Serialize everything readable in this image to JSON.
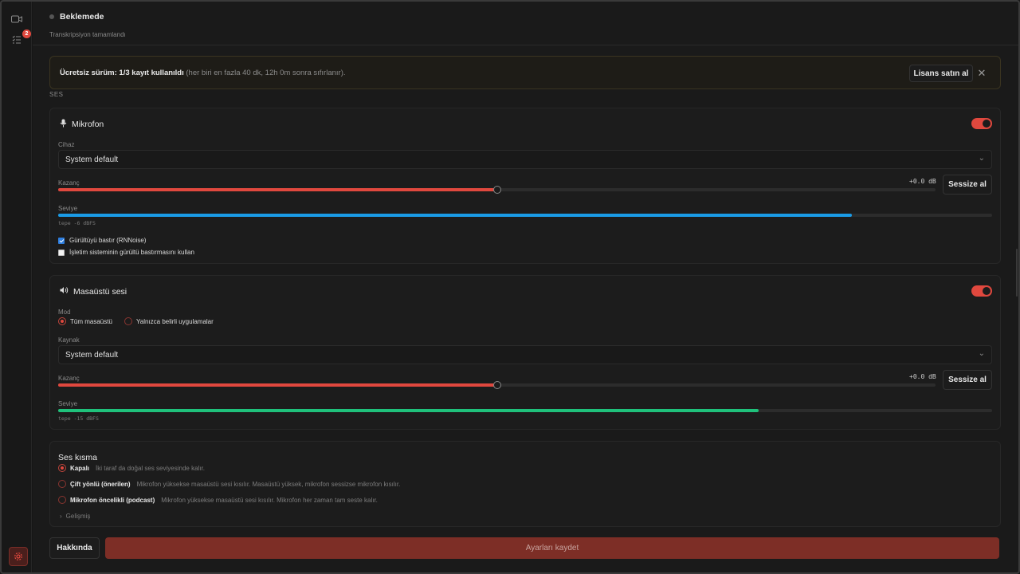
{
  "sidebar": {
    "notification_count": "2"
  },
  "status": {
    "title": "Beklemede",
    "subtitle": "Transkripsiyon tamamlandı"
  },
  "banner": {
    "bold_text": "Ücretsiz sürüm: 1/3 kayıt kullanıldı",
    "muted_text": " (her biri en fazla 40 dk, 12h 0m sonra sıfırlanır).",
    "license_button": "Lisans satın al",
    "close_icon": "close-icon"
  },
  "section_label": "SES",
  "microphone": {
    "title": "Mikrofon",
    "enabled": true,
    "device_label": "Cihaz",
    "device_value": "System default",
    "gain_label": "Kazanç",
    "gain_db": "+0.0 dB",
    "gain_fraction": 0.5,
    "mute_button": "Sessize al",
    "level_label": "Seviye",
    "level_fraction": 0.85,
    "level_color": "#1a9be6",
    "peak_text": "tepe -6 dBFS",
    "noise_suppress_label": "Gürültüyü bastır (RNNoise)",
    "noise_suppress_checked": true,
    "os_noise_label": "İşletim sisteminin gürültü bastırmasını kullan",
    "os_noise_checked": false
  },
  "desktop": {
    "title": "Masaüstü sesi",
    "enabled": true,
    "mode_label": "Mod",
    "mode_options": [
      "Tüm masaüstü",
      "Yalnızca belirli uygulamalar"
    ],
    "mode_selected": 0,
    "source_label": "Kaynak",
    "source_value": "System default",
    "gain_label": "Kazanç",
    "gain_db": "+0.0 dB",
    "gain_fraction": 0.5,
    "mute_button": "Sessize al",
    "level_label": "Seviye",
    "level_fraction": 0.75,
    "level_color": "#1fc17b",
    "peak_text": "tepe -15 dBFS"
  },
  "ducking": {
    "title": "Ses kısma",
    "options": [
      {
        "label": "Kapalı",
        "desc": "İki taraf da doğal ses seviyesinde kalır."
      },
      {
        "label": "Çift yönlü (önerilen)",
        "desc": "Mikrofon yüksekse masaüstü sesi kısılır. Masaüstü yüksek, mikrofon sessizse mikrofon kısılır."
      },
      {
        "label": "Mikrofon öncelikli (podcast)",
        "desc": "Mikrofon yüksekse masaüstü sesi kısılır. Mikrofon her zaman tam seste kalır."
      }
    ],
    "selected": 0,
    "advanced_label": "Gelişmiş"
  },
  "footer": {
    "about_button": "Hakkında",
    "save_button": "Ayarları kaydet"
  },
  "colors": {
    "accent": "#e0483e",
    "save_bg": "#7d2e26"
  }
}
